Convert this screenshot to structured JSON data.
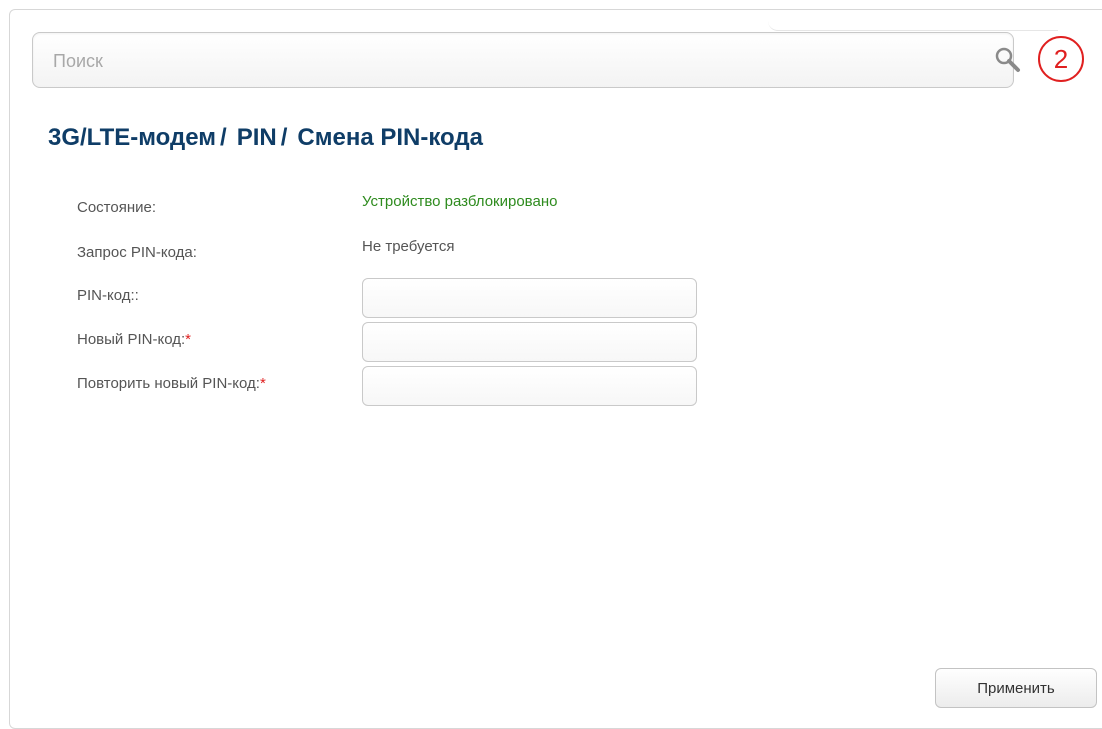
{
  "search": {
    "placeholder": "Поиск",
    "value": ""
  },
  "badge": {
    "number": "2",
    "color": "#e02020"
  },
  "breadcrumb": {
    "items": [
      "3G/LTE-модем",
      "PIN",
      "Смена PIN-кода"
    ],
    "separator": "/",
    "color": "#0f3d67"
  },
  "status": {
    "state_label": "Состояние:",
    "state_value": "Устройство разблокировано",
    "state_color": "#2e8b1e",
    "pin_request_label": "Запрос PIN-кода:",
    "pin_request_value": "Не требуется"
  },
  "form": {
    "pin_label": "PIN-код::",
    "pin_value": "",
    "new_pin_label": "Новый PIN-код:",
    "new_pin_value": "",
    "repeat_pin_label": "Повторить новый PIN-код:",
    "repeat_pin_value": "",
    "required_mark": "*"
  },
  "actions": {
    "apply_label": "Применить"
  }
}
